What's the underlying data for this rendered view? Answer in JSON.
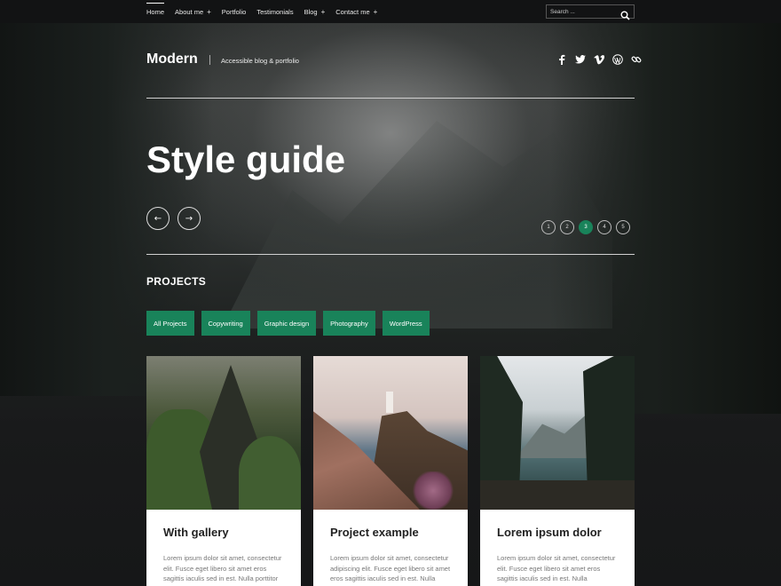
{
  "nav": {
    "items": [
      {
        "label": "Home",
        "active": true,
        "has_submenu": false
      },
      {
        "label": "About me",
        "active": false,
        "has_submenu": true
      },
      {
        "label": "Portfolio",
        "active": false,
        "has_submenu": false
      },
      {
        "label": "Testimonials",
        "active": false,
        "has_submenu": false
      },
      {
        "label": "Blog",
        "active": false,
        "has_submenu": true
      },
      {
        "label": "Contact me",
        "active": false,
        "has_submenu": true
      }
    ],
    "submenu_glyph": "+"
  },
  "search": {
    "placeholder": "Search ..."
  },
  "header": {
    "brand": "Modern",
    "tagline": "Accessible blog & portfolio",
    "social_icons": [
      "facebook-icon",
      "twitter-icon",
      "vimeo-icon",
      "wordpress-icon",
      "link-icon"
    ]
  },
  "hero": {
    "title": "Style guide",
    "prev_glyph": "←",
    "next_glyph": "→",
    "pages": [
      "1",
      "2",
      "3",
      "4",
      "5"
    ],
    "active_page": "3"
  },
  "projects": {
    "heading": "PROJECTS",
    "filters": [
      "All Projects",
      "Copywriting",
      "Graphic design",
      "Photography",
      "WordPress"
    ],
    "cards": [
      {
        "title": "With gallery",
        "text": "Lorem ipsum dolor sit amet, consectetur elit. Fusce eget libero sit amet eros sagittis iaculis sed in est. Nulla porttitor",
        "image": "forest"
      },
      {
        "title": "Project example",
        "text": "Lorem ipsum dolor sit amet, consectetur adipiscing elit. Fusce eget libero sit amet eros sagittis iaculis sed in est. Nulla",
        "image": "lighthouse"
      },
      {
        "title": "Lorem ipsum dolor",
        "text": "Lorem ipsum dolor sit amet, consectetur elit. Fusce eget libero sit amet eros sagittis iaculis sed in est. Nulla",
        "image": "lake"
      }
    ]
  },
  "colors": {
    "accent": "#19835a",
    "topbar": "#121314",
    "background": "#161718"
  }
}
